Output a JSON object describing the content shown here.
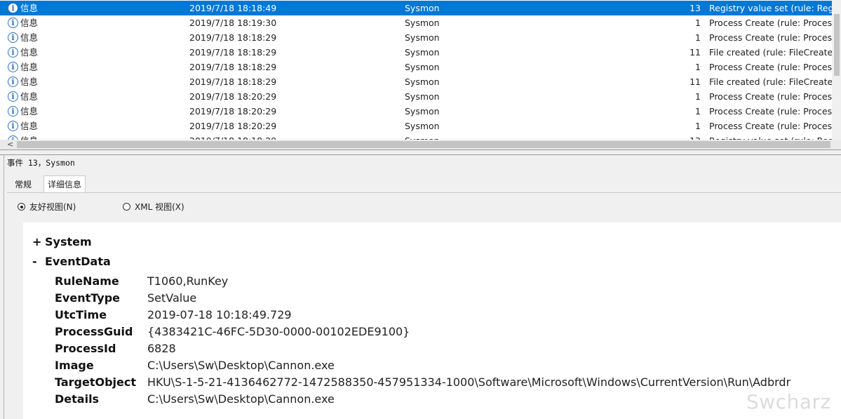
{
  "event_list": {
    "rows": [
      {
        "level": "信息",
        "datetime": "2019/7/18 18:18:49",
        "source": "Sysmon",
        "event_id": "13",
        "category": "Registry value set (rule: Registry)"
      },
      {
        "level": "信息",
        "datetime": "2019/7/18 18:19:30",
        "source": "Sysmon",
        "event_id": "1",
        "category": "Process Create (rule: ProcessCreate)"
      },
      {
        "level": "信息",
        "datetime": "2019/7/18 18:18:29",
        "source": "Sysmon",
        "event_id": "1",
        "category": "Process Create (rule: ProcessCreate)"
      },
      {
        "level": "信息",
        "datetime": "2019/7/18 18:18:29",
        "source": "Sysmon",
        "event_id": "11",
        "category": "File created (rule: FileCreate)"
      },
      {
        "level": "信息",
        "datetime": "2019/7/18 18:18:29",
        "source": "Sysmon",
        "event_id": "1",
        "category": "Process Create (rule: ProcessCreate)"
      },
      {
        "level": "信息",
        "datetime": "2019/7/18 18:18:29",
        "source": "Sysmon",
        "event_id": "11",
        "category": "File created (rule: FileCreate)"
      },
      {
        "level": "信息",
        "datetime": "2019/7/18 18:20:29",
        "source": "Sysmon",
        "event_id": "1",
        "category": "Process Create (rule: ProcessCreate)"
      },
      {
        "level": "信息",
        "datetime": "2019/7/18 18:20:29",
        "source": "Sysmon",
        "event_id": "1",
        "category": "Process Create (rule: ProcessCreate)"
      },
      {
        "level": "信息",
        "datetime": "2019/7/18 18:20:29",
        "source": "Sysmon",
        "event_id": "1",
        "category": "Process Create (rule: ProcessCreate)"
      },
      {
        "level": "信息",
        "datetime": "2019/7/18 18:18:29",
        "source": "Sysmon",
        "event_id": "13",
        "category": "Registry value set (rule: Registry)"
      }
    ],
    "selected_index": 0
  },
  "detail_header": "事件 13，Sysmon",
  "tabs": [
    "常规",
    "详细信息"
  ],
  "view_options": {
    "friendly": "友好视图(N)",
    "xml": "XML 视图(X)",
    "selected": "friendly"
  },
  "event_detail": {
    "system_label": "System",
    "system_sign": "+",
    "eventdata_label": "EventData",
    "eventdata_sign": "-",
    "fields": [
      {
        "key": "RuleName",
        "value": "T1060,RunKey"
      },
      {
        "key": "EventType",
        "value": "SetValue"
      },
      {
        "key": "UtcTime",
        "value": "2019-07-18 10:18:49.729"
      },
      {
        "key": "ProcessGuid",
        "value": "{4383421C-46FC-5D30-0000-00102EDE9100}"
      },
      {
        "key": "ProcessId",
        "value": "6828"
      },
      {
        "key": "Image",
        "value": "C:\\Users\\Sw\\Desktop\\Cannon.exe"
      },
      {
        "key": "TargetObject",
        "value": "HKU\\S-1-5-21-4136462772-1472588350-457951334-1000\\Software\\Microsoft\\Windows\\CurrentVersion\\Run\\Adbrdr"
      },
      {
        "key": "Details",
        "value": "C:\\Users\\Sw\\Desktop\\Cannon.exe"
      }
    ]
  },
  "watermark": "Swcharz",
  "icons": {
    "info": "info-icon",
    "scroll_left": "chevron-left-icon"
  },
  "colors": {
    "selection": "#0078d7",
    "info_icon": "#2f6fc2"
  }
}
